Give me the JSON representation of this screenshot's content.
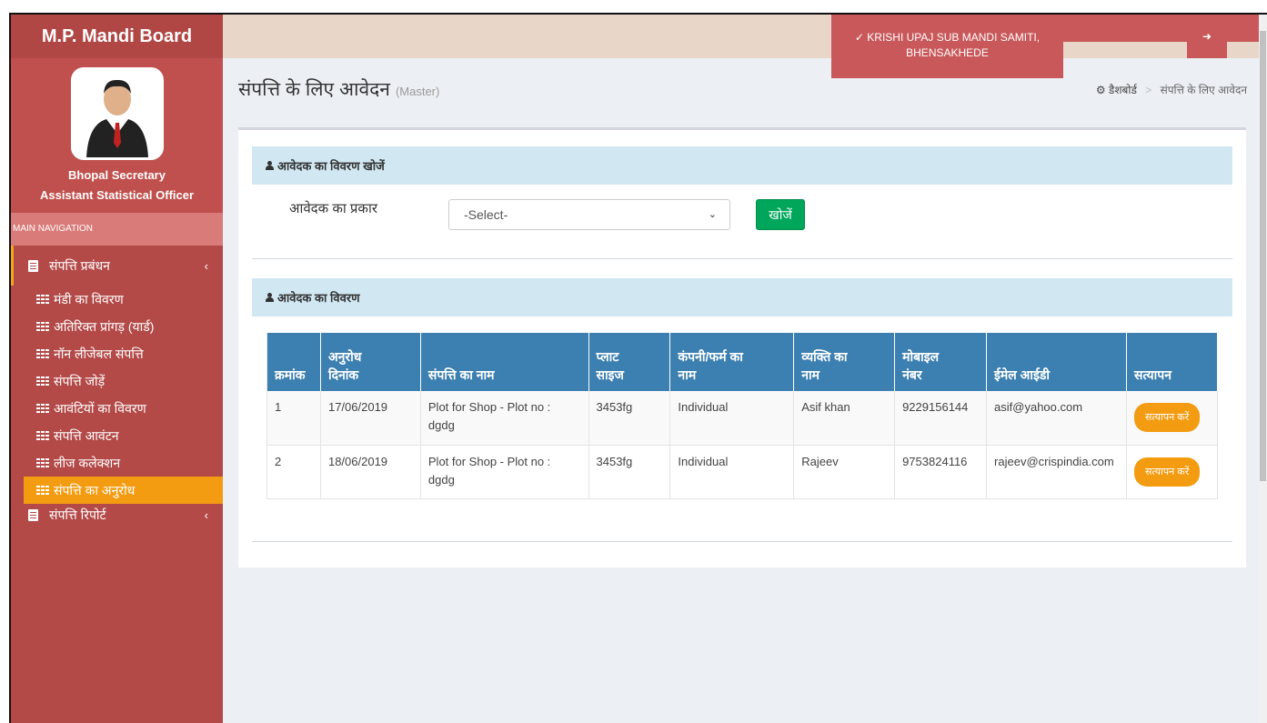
{
  "app": {
    "brand": "M.P. Mandi Board",
    "mandi_line1": "KRISHI UPAJ SUB MANDI SAMITI,",
    "mandi_line2": "BHENSAKHEDE"
  },
  "user": {
    "name": "Bhopal Secretary",
    "role": "Assistant Statistical Officer"
  },
  "sidebar": {
    "header": "MAIN NAVIGATION",
    "parent1": "संपत्ति प्रबंधन",
    "items": [
      {
        "label": "मंडी का विवरण"
      },
      {
        "label": "अतिरिक्त प्रांगड़ (यार्ड)"
      },
      {
        "label": " नॉन लीजेबल संपत्ति"
      },
      {
        "label": "संपत्ति जोड़ें"
      },
      {
        "label": "आवंटियों का विवरण"
      },
      {
        "label": "संपत्ति आवंटन"
      },
      {
        "label": "लीज कलेक्शन"
      },
      {
        "label": "संपत्ति का अनुरोध"
      }
    ],
    "parent2": "संपत्ति रिपोर्ट"
  },
  "page": {
    "title": "संपत्ति के लिए आवेदन",
    "subtitle": "(Master)",
    "breadcrumb_home": "डैशबोर्ड",
    "breadcrumb_current": "संपत्ति के लिए आवेदन"
  },
  "search_box": {
    "header": "आवेदक का विवरण खोजें",
    "label": "आवेदक का प्रकार",
    "select_value": "-Select-",
    "button": "खोजें"
  },
  "details_box": {
    "header": "आवेदक का विवरण",
    "columns": {
      "c1": "क्रमांक",
      "c2a": "अनुरोध",
      "c2b": "दिनांक",
      "c3": "संपत्ति का नाम",
      "c4a": "प्लाट",
      "c4b": "साइज",
      "c5a": "कंपनी/फर्म का",
      "c5b": "नाम",
      "c6a": "व्यक्ति का",
      "c6b": "नाम",
      "c7a": "मोबाइल",
      "c7b": "नंबर",
      "c8": "ईमेल आईडी",
      "c9": "सत्यापन"
    },
    "rows": [
      {
        "sno": "1",
        "date": "17/06/2019",
        "prop1": "Plot for Shop - Plot no :",
        "prop2": "dgdg",
        "size": "3453fg",
        "firm": "Individual",
        "person": "Asif khan",
        "mobile": "9229156144",
        "email": "asif@yahoo.com",
        "action": "सत्यापन करें"
      },
      {
        "sno": "2",
        "date": "18/06/2019",
        "prop1": "Plot for Shop - Plot no :",
        "prop2": "dgdg",
        "size": "3453fg",
        "firm": "Individual",
        "person": "Rajeev",
        "mobile": "9753824116",
        "email": "rajeev@crispindia.com",
        "action": "सत्यापन करें"
      }
    ]
  },
  "colors": {
    "sidebar": "#b34a48",
    "active_item": "#f39c12",
    "table_header": "#3c7fb1",
    "search_button": "#00a65a"
  }
}
